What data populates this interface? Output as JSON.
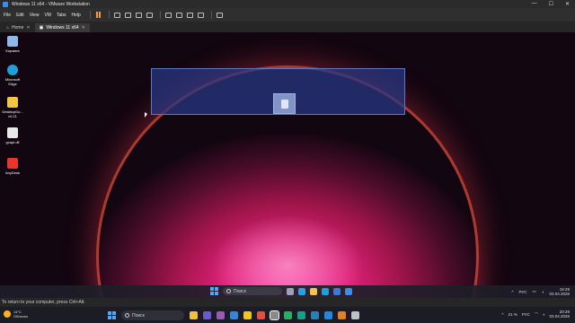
{
  "window": {
    "title": "Windows 11 x64 - VMware Workstation",
    "controls": [
      "—",
      "☐",
      "✕"
    ]
  },
  "menubar": {
    "items": [
      "File",
      "Edit",
      "View",
      "VM",
      "Tabs",
      "Help"
    ]
  },
  "tabs": [
    {
      "label": "Home",
      "active": false
    },
    {
      "label": "Windows 11 x64",
      "active": true
    }
  ],
  "desktop_icons": [
    {
      "label": "Корзина",
      "icon": "recycle-bin-icon",
      "color": "#8fb8e8"
    },
    {
      "label": "Microsoft Edge",
      "icon": "edge-icon",
      "color": "#1e9fd8"
    },
    {
      "label": "DesktopGo... v0.21",
      "icon": "folder-icon",
      "color": "#f4c542"
    },
    {
      "label": "gcapt.dll",
      "icon": "file-icon",
      "color": "#e8e8e8"
    },
    {
      "label": "AnyDesk",
      "icon": "anydesk-icon",
      "color": "#e8362e"
    }
  ],
  "guest_taskbar": {
    "search_placeholder": "Поиск",
    "lang": "РУС",
    "time": "15:29",
    "date": "03.04.2026",
    "apps": [
      {
        "icon": "task-view-icon",
        "color": "#9aa4b8"
      },
      {
        "icon": "edge-icon",
        "color": "#2aa0e0"
      },
      {
        "icon": "explorer-icon",
        "color": "#f3c54a"
      },
      {
        "icon": "edge-icon",
        "color": "#1e9fd8"
      },
      {
        "icon": "mail-icon",
        "color": "#3a7bd5"
      },
      {
        "icon": "store-icon",
        "color": "#3c8fe0"
      }
    ]
  },
  "statusbar": {
    "text": "To return to your computer, press Ctrl+Alt."
  },
  "host_taskbar": {
    "weather_temp": "14°C",
    "weather_desc": "Облачно",
    "search_placeholder": "Поиск",
    "lang": "РУС",
    "battery": "21 %",
    "time": "20:29",
    "date": "03.04.2026",
    "apps": [
      {
        "icon": "file-explorer-icon",
        "color": "#f0c040"
      },
      {
        "icon": "app-icon",
        "color": "#6a5acd"
      },
      {
        "icon": "app-icon",
        "color": "#9b59b6"
      },
      {
        "icon": "app-icon",
        "color": "#2e86de"
      },
      {
        "icon": "yandex-icon",
        "color": "#f5c518"
      },
      {
        "icon": "app-icon",
        "color": "#e74c3c"
      },
      {
        "icon": "vmware-icon",
        "color": "#8a8a8a"
      },
      {
        "icon": "app-icon",
        "color": "#27ae60"
      },
      {
        "icon": "app-icon",
        "color": "#16a085"
      },
      {
        "icon": "app-icon",
        "color": "#2980b9"
      },
      {
        "icon": "vscode-icon",
        "color": "#1e88e5"
      },
      {
        "icon": "app-icon",
        "color": "#e67e22"
      },
      {
        "icon": "app-icon",
        "color": "#bdc3c7"
      }
    ]
  }
}
